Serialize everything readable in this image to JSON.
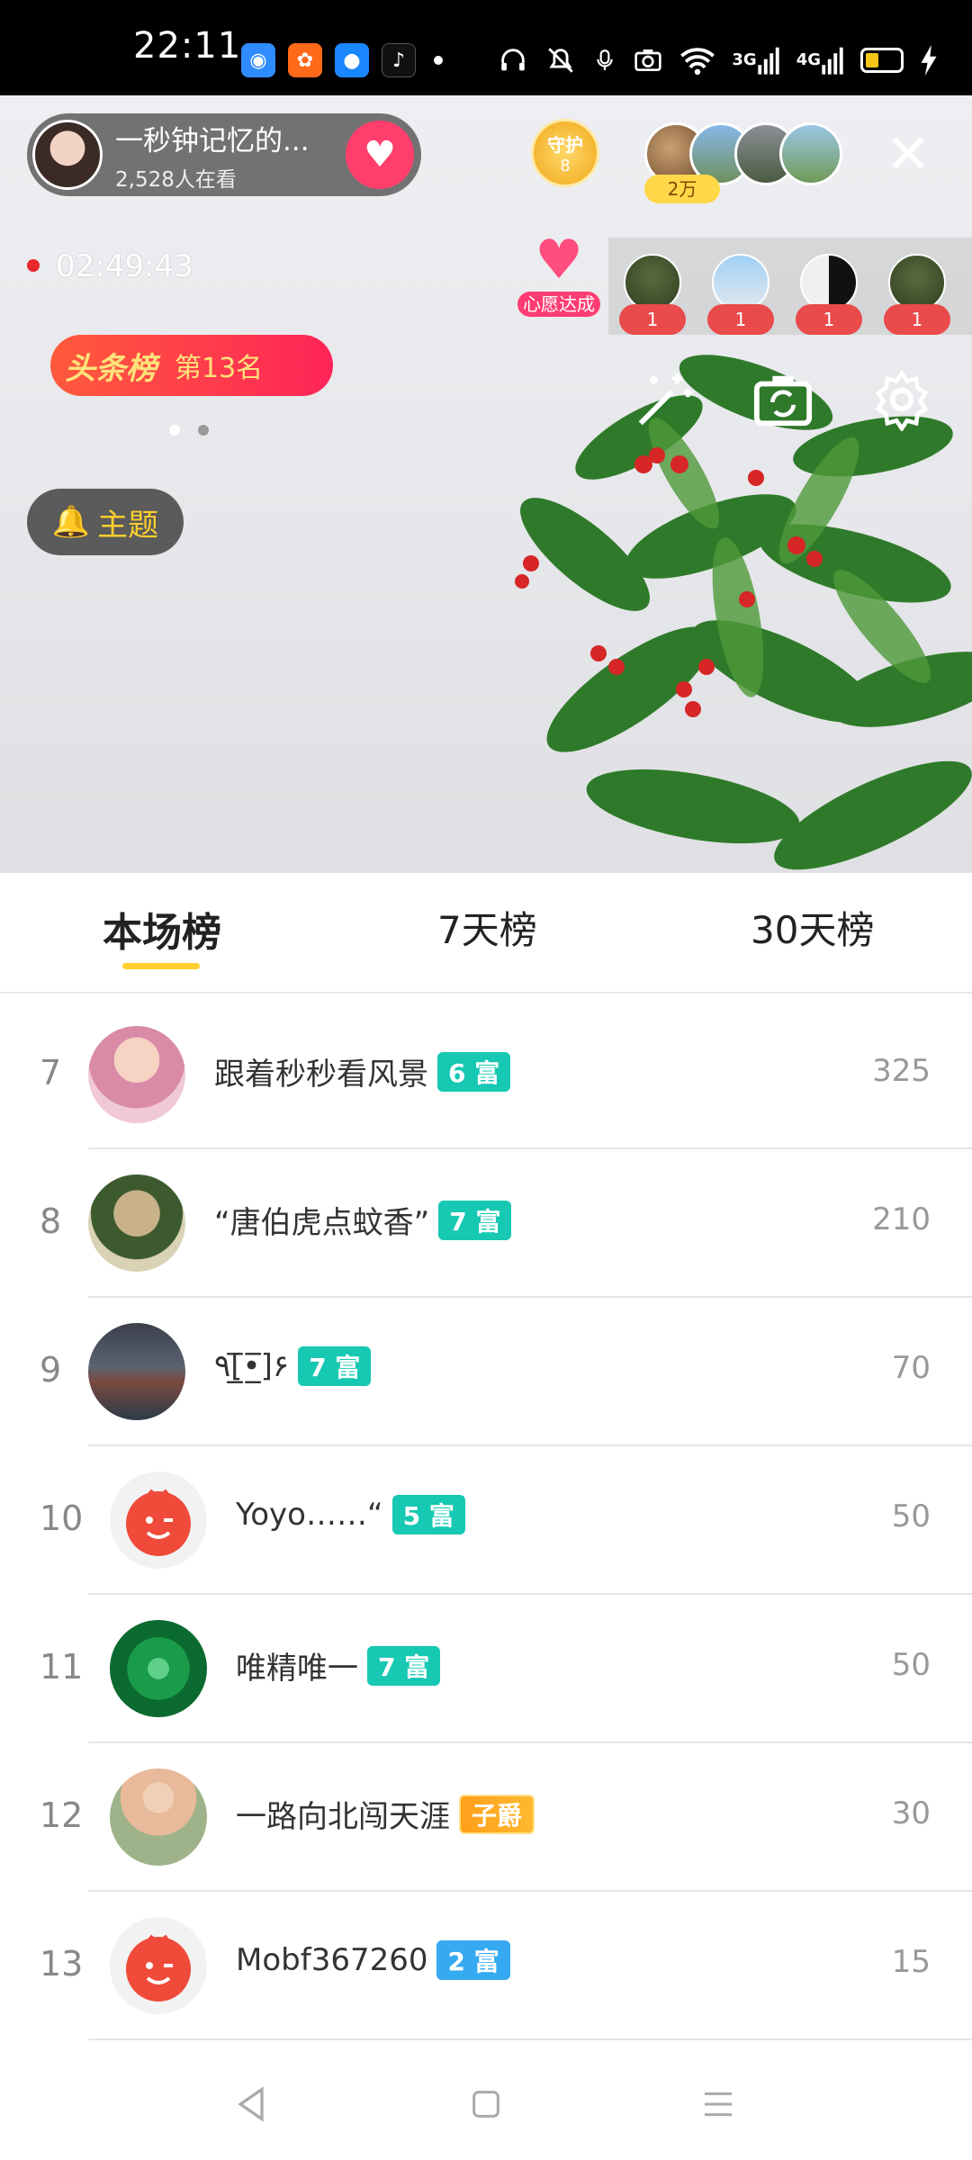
{
  "status_bar": {
    "time": "22:11",
    "signal_3g": "3G",
    "signal_4g": "4G"
  },
  "live": {
    "host_name": "一秒钟记忆的...",
    "viewers": "2,528人在看",
    "guard": {
      "label": "守护",
      "count": "8"
    },
    "fans_count": "2万",
    "duration": "02:49:43",
    "wish_label": "心愿达成",
    "gifter_counts": [
      "1",
      "1",
      "1",
      "1"
    ],
    "rank_badge": {
      "title": "头条榜",
      "position": "第13名"
    },
    "topic_label": "主题"
  },
  "tabs": [
    "本场榜",
    "7天榜",
    "30天榜"
  ],
  "active_tab": 0,
  "rows": [
    {
      "rank": "7",
      "name": "跟着秒秒看风景",
      "level": "6 富",
      "level_style": "teal",
      "score": "325"
    },
    {
      "rank": "8",
      "name": "“唐伯虎点蚊香”",
      "level": "7 富",
      "level_style": "teal",
      "score": "210"
    },
    {
      "rank": "9",
      "name": "٩[̲̅•̲̅]۶",
      "level": "7 富",
      "level_style": "teal",
      "score": "70"
    },
    {
      "rank": "10",
      "name": "Yoyo……“",
      "level": "5 富",
      "level_style": "teal",
      "score": "50"
    },
    {
      "rank": "11",
      "name": "唯精唯一",
      "level": "7 富",
      "level_style": "teal",
      "score": "50"
    },
    {
      "rank": "12",
      "name": "一路向北闯天涯",
      "level": "子爵",
      "level_style": "gold",
      "score": "30"
    },
    {
      "rank": "13",
      "name": "Mobf367260",
      "level": "2 富",
      "level_style": "blue",
      "score": "15"
    }
  ]
}
